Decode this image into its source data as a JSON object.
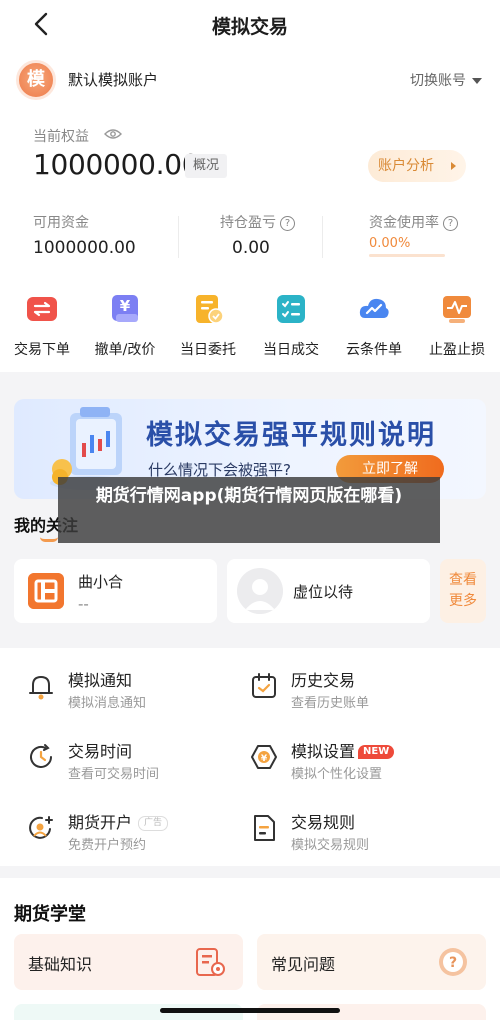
{
  "nav": {
    "title": "模拟交易",
    "back_icon": "back-arrow-icon"
  },
  "account": {
    "avatar_char": "模",
    "name": "默认模拟账户",
    "switch_label": "切换账号",
    "equity_label": "当前权益",
    "equity_value": "1000000.00",
    "overview_label": "概况",
    "analysis_label": "账户分析",
    "stats": [
      {
        "label": "可用资金",
        "value": "1000000.00"
      },
      {
        "label": "持仓盈亏",
        "value": "0.00"
      },
      {
        "label": "资金使用率",
        "value": "0.00%"
      }
    ],
    "usage_fraction": 0.0
  },
  "actions": [
    {
      "label": "交易下单",
      "icon": "order-icon"
    },
    {
      "label": "撤单/改价",
      "icon": "cancel-order-icon"
    },
    {
      "label": "当日委托",
      "icon": "daily-entrust-icon"
    },
    {
      "label": "当日成交",
      "icon": "daily-deal-icon"
    },
    {
      "label": "云条件单",
      "icon": "cloud-condition-icon"
    },
    {
      "label": "止盈止损",
      "icon": "stop-profit-loss-icon"
    }
  ],
  "banner": {
    "title": "模拟交易强平规则说明",
    "subtitle": "什么情况下会被强平?",
    "button": "立即了解"
  },
  "overlay_text": "期货行情网app(期货行情网页版在哪看)",
  "follow": {
    "title": "我的关注",
    "card1": {
      "name": "曲小合",
      "sub": "--"
    },
    "card2": {
      "name": "虚位以待"
    },
    "more_line1": "查看",
    "more_line2": "更多"
  },
  "features": [
    {
      "title": "模拟通知",
      "sub": "模拟消息通知",
      "icon": "bell-icon"
    },
    {
      "title": "历史交易",
      "sub": "查看历史账单",
      "icon": "calendar-history-icon"
    },
    {
      "title": "交易时间",
      "sub": "查看可交易时间",
      "icon": "clock-icon"
    },
    {
      "title": "模拟设置",
      "sub": "模拟个性化设置",
      "icon": "settings-yen-icon",
      "tag": "NEW"
    },
    {
      "title": "期货开户",
      "sub": "免费开户预约",
      "icon": "open-account-icon",
      "tag": "广告"
    },
    {
      "title": "交易规则",
      "sub": "模拟交易规则",
      "icon": "rules-document-icon"
    }
  ],
  "school": {
    "title": "期货学堂",
    "cards": [
      {
        "label": "基础知识",
        "icon": "knowledge-icon"
      },
      {
        "label": "常见问题",
        "icon": "question-icon"
      }
    ]
  },
  "colors": {
    "accent": "#f08a3c",
    "brand_blue": "#2a4fa8",
    "orange_btn": "#f06b1e"
  }
}
